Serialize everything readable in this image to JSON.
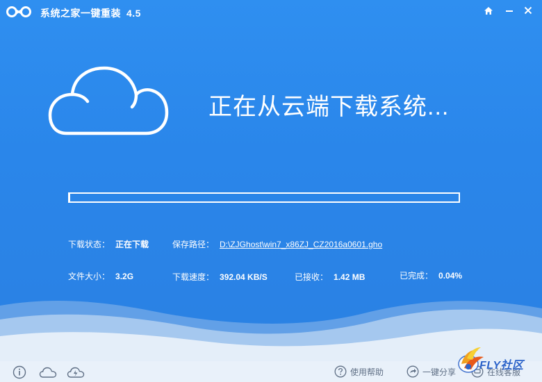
{
  "app": {
    "title": "系统之家一键重装",
    "version": "4.5"
  },
  "window_controls": {
    "home_icon": "home-icon",
    "minimize_icon": "minimize-icon",
    "close_icon": "close-icon"
  },
  "hero": {
    "icon": "cloud-icon",
    "headline": "正在从云端下载系统..."
  },
  "progress": {
    "completed_fraction": 0.0004
  },
  "download_info": {
    "status_label": "下载状态：",
    "status_value": "正在下载",
    "path_label": "保存路径：",
    "path_value": "D:\\ZJGhost\\win7_x86ZJ_CZ2016a0601.gho",
    "size_label": "文件大小：",
    "size_value": "3.2G",
    "speed_label": "下载速度：",
    "speed_value": "392.04 KB/S",
    "received_label": "已接收：",
    "received_value": "1.42 MB",
    "completed_label": "已完成：",
    "completed_value": "0.04%"
  },
  "bottom_bar": {
    "icons": [
      "info-icon",
      "cloud-icon",
      "cloud-lightning-icon"
    ],
    "help_label": "使用帮助",
    "share_label": "一键分享",
    "feedback_label": "在线客服"
  },
  "watermark": {
    "text": "FLY社区"
  },
  "colors": {
    "background": "#2f8ff0",
    "wave_light": "#dce8f6",
    "text": "#ffffff",
    "footer_text": "#5f6f85"
  }
}
